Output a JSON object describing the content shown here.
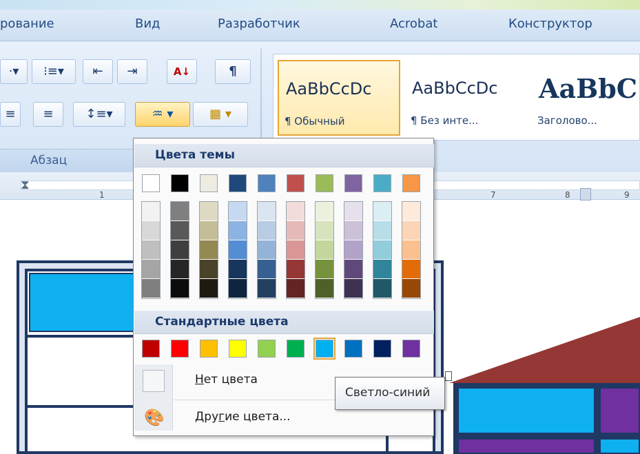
{
  "ribbon_tabs": [
    "рование",
    "Вид",
    "Разработчик",
    "Acrobat",
    "Конструктор"
  ],
  "paragraph_group": {
    "label": "Абзац",
    "pilcrow": "¶",
    "sort_glyph": "А↓"
  },
  "styles": [
    {
      "sample": "AaBbCcDc",
      "name": "¶ Обычный"
    },
    {
      "sample": "AaBbCcDc",
      "name": "¶ Без инте..."
    },
    {
      "sample": "AaBbC",
      "name": "Заголово..."
    }
  ],
  "ruler": {
    "ticks": [
      "1",
      "7",
      "8",
      "9"
    ]
  },
  "color_picker": {
    "theme_header": "Цвета темы",
    "theme_colors": [
      "#ffffff",
      "#000000",
      "#eeece1",
      "#1f497d",
      "#4f81bd",
      "#c0504d",
      "#9bbb59",
      "#8064a2",
      "#4bacc6",
      "#f79646"
    ],
    "theme_shades": [
      [
        "#f2f2f2",
        "#d8d8d8",
        "#bfbfbf",
        "#a5a5a5",
        "#7f7f7f"
      ],
      [
        "#7f7f7f",
        "#595959",
        "#3f3f3f",
        "#262626",
        "#0c0c0c"
      ],
      [
        "#ddd9c3",
        "#c4bd97",
        "#938953",
        "#494429",
        "#1d1b10"
      ],
      [
        "#c6d9f0",
        "#8db3e2",
        "#548dd4",
        "#17365d",
        "#0f243e"
      ],
      [
        "#dbe5f1",
        "#b8cce4",
        "#95b3d7",
        "#366092",
        "#244061"
      ],
      [
        "#f2dcdb",
        "#e5b9b7",
        "#d99694",
        "#953734",
        "#632423"
      ],
      [
        "#ebf1dd",
        "#d7e3bc",
        "#c3d69b",
        "#76923c",
        "#4f6128"
      ],
      [
        "#e5e0ec",
        "#ccc1d9",
        "#b2a2c7",
        "#5f497a",
        "#3f3151"
      ],
      [
        "#dbeef3",
        "#b7dde8",
        "#92cddc",
        "#31859b",
        "#205867"
      ],
      [
        "#fdeada",
        "#fbd5b5",
        "#fac08f",
        "#e36c09",
        "#974806"
      ]
    ],
    "standard_header": "Стандартные цвета",
    "standard_colors": [
      "#c00000",
      "#ff0000",
      "#ffc000",
      "#ffff00",
      "#92d050",
      "#00b050",
      "#00b0f0",
      "#0070c0",
      "#002060",
      "#7030a0"
    ],
    "selected_standard_index": 6,
    "no_color_label": "Нет цвета",
    "no_color_hotkey": "Н",
    "no_color_rest": "ет цвета",
    "more_colors_prefix": "Дру",
    "more_colors_hotkey": "г",
    "more_colors_rest": "ие цвета..."
  },
  "tooltip": "Светло-синий"
}
